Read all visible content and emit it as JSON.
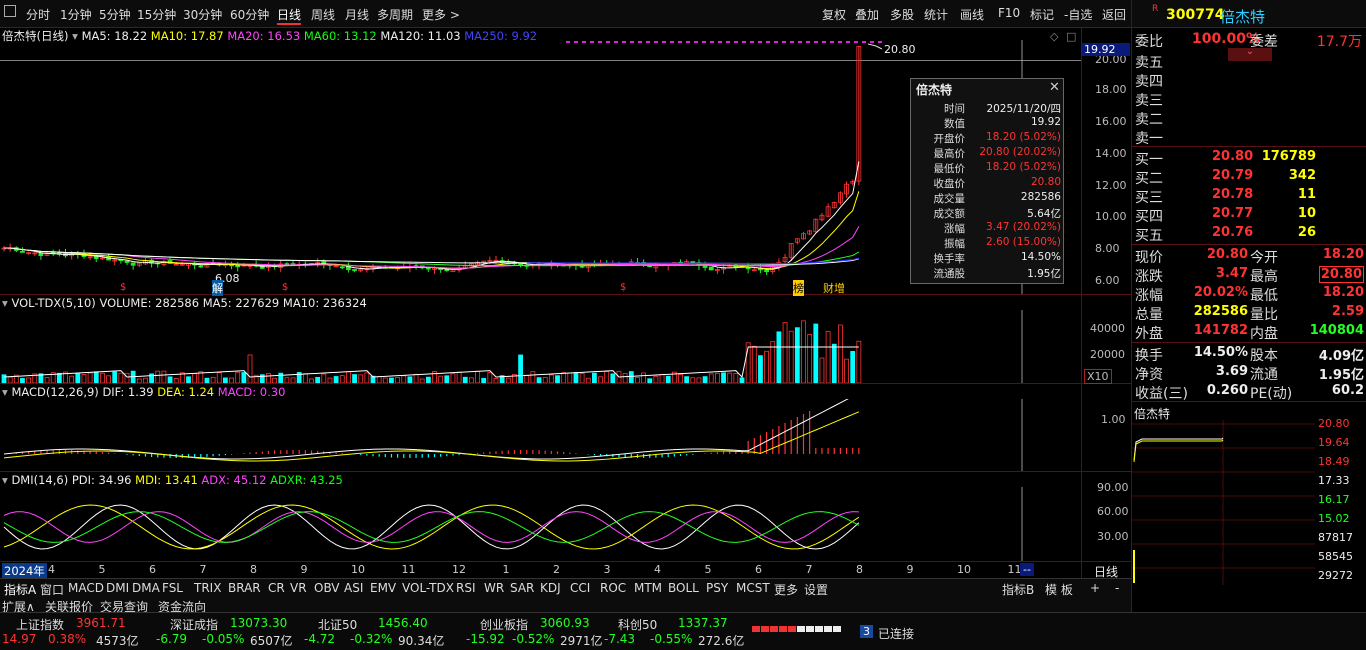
{
  "toolbar": {
    "periods": [
      "分时",
      "1分钟",
      "5分钟",
      "15分钟",
      "30分钟",
      "60分钟",
      "日线",
      "周线",
      "月线",
      "多周期",
      "更多 >"
    ],
    "actions": [
      "复权",
      "叠加",
      "多股",
      "统计",
      "画线",
      "F10",
      "标记",
      "-自选",
      "返回"
    ]
  },
  "stock": {
    "code": "300774",
    "name": "倍杰特",
    "badge": "R"
  },
  "ma_bar": {
    "title": "倍杰特(日线)",
    "ma5": "MA5: 18.22",
    "ma10": "MA10: 17.87",
    "ma20": "MA20: 16.53",
    "ma60": "MA60: 13.12",
    "ma120": "MA120: 11.03",
    "ma250": "MA250: 9.92"
  },
  "price_axis": [
    "20.00",
    "18.00",
    "16.00",
    "14.00",
    "12.00",
    "10.00",
    "8.00",
    "6.00"
  ],
  "chart_labels": {
    "high": "20.80",
    "low": "6.08",
    "cursor": "19.92",
    "marker_jie": "解",
    "marker_bang": "榜",
    "marker_zeng": "财增"
  },
  "vol_bar": {
    "title": "VOL-TDX(5,10)",
    "volume": "VOLUME: 282586",
    "ma5": "MA5: 227629",
    "ma10": "MA10: 236324"
  },
  "vol_axis": [
    "40000",
    "20000",
    "X10"
  ],
  "macd_bar": {
    "title": "MACD(12,26,9)",
    "dif": "DIF: 1.39",
    "dea": "DEA: 1.24",
    "macd": "MACD: 0.30"
  },
  "macd_axis": [
    "1.00"
  ],
  "dmi_bar": {
    "title": "DMI(14,6)",
    "pdi": "PDI: 34.96",
    "mdi": "MDI: 13.41",
    "adx": "ADX: 45.12",
    "adxr": "ADXR: 43.25"
  },
  "dmi_axis": [
    "90.00",
    "60.00",
    "30.00"
  ],
  "date_axis": {
    "year": "2024年",
    "months": [
      "4",
      "5",
      "6",
      "7",
      "8",
      "9",
      "10",
      "11",
      "12",
      "1",
      "2",
      "3",
      "4",
      "5",
      "6",
      "7",
      "8",
      "9",
      "10",
      "11"
    ],
    "cursor": "--",
    "right": "日线"
  },
  "tooltip": {
    "title": "倍杰特",
    "rows": [
      [
        "时间",
        "2025/11/20/四"
      ],
      [
        "数值",
        "19.92"
      ],
      [
        "开盘价",
        "18.20 (5.02%)"
      ],
      [
        "最高价",
        "20.80 (20.02%)"
      ],
      [
        "最低价",
        "18.20 (5.02%)"
      ],
      [
        "收盘价",
        "20.80"
      ],
      [
        "成交量",
        "282586"
      ],
      [
        "成交额",
        "5.64亿"
      ],
      [
        "涨幅",
        "3.47 (20.02%)"
      ],
      [
        "振幅",
        "2.60 (15.00%)"
      ],
      [
        "换手率",
        "14.50%"
      ],
      [
        "流通股",
        "1.95亿"
      ]
    ]
  },
  "quote": {
    "weibi": "委比",
    "weibi_v": "100.00%",
    "weicha": "委差",
    "weicha_v": "17.7万",
    "sells": [
      [
        "卖五",
        ""
      ],
      [
        "卖四",
        ""
      ],
      [
        "卖三",
        ""
      ],
      [
        "卖二",
        ""
      ],
      [
        "卖一",
        ""
      ]
    ],
    "buys": [
      [
        "买一",
        "20.80",
        "176789"
      ],
      [
        "买二",
        "20.79",
        "342"
      ],
      [
        "买三",
        "20.78",
        "11"
      ],
      [
        "买四",
        "20.77",
        "10"
      ],
      [
        "买五",
        "20.76",
        "26"
      ]
    ],
    "stats": [
      [
        "现价",
        "20.80",
        "今开",
        "18.20"
      ],
      [
        "涨跌",
        "3.47",
        "最高",
        "20.80"
      ],
      [
        "涨幅",
        "20.02%",
        "最低",
        "18.20"
      ],
      [
        "总量",
        "282586",
        "量比",
        "2.59"
      ],
      [
        "外盘",
        "141782",
        "内盘",
        "140804"
      ],
      [
        "换手",
        "14.50%",
        "股本",
        "4.09亿"
      ],
      [
        "净资",
        "3.69",
        "流通",
        "1.95亿"
      ],
      [
        "收益(三)",
        "0.260",
        "PE(动)",
        "60.2"
      ]
    ]
  },
  "mini": {
    "title": "倍杰特",
    "axis": [
      "20.80",
      "19.64",
      "18.49",
      "17.33",
      "16.17",
      "15.02",
      "87817",
      "58545",
      "29272"
    ]
  },
  "bottom_tabs": [
    "指标A",
    "窗口",
    "MACD",
    "DMI",
    "DMA",
    "FSL",
    "TRIX",
    "BRAR",
    "CR",
    "VR",
    "OBV",
    "ASI",
    "EMV",
    "VOL-TDX",
    "RSI",
    "WR",
    "SAR",
    "KDJ",
    "CCI",
    "ROC",
    "MTM",
    "BOLL",
    "PSY",
    "MCST",
    "更多",
    "设置"
  ],
  "bottom_tabs_right": [
    "指标B",
    "模 板",
    "+",
    "-"
  ],
  "ext_tabs": [
    "扩展∧",
    "关联报价",
    "交易查询",
    "资金流向"
  ],
  "status": {
    "sh": [
      "上证指数",
      "3961.71",
      "14.97",
      "0.38%",
      "4573亿"
    ],
    "sz": [
      "深证成指",
      "13073.30",
      "-6.79",
      "-0.05%",
      "6507亿"
    ],
    "bz": [
      "北证50",
      "1456.40",
      "-4.72",
      "-0.32%",
      "90.34亿"
    ],
    "cy": [
      "创业板指",
      "3060.93",
      "-15.92",
      "-0.52%",
      "2971亿"
    ],
    "kc": [
      "科创50",
      "1337.37",
      "-7.43",
      "-0.55%",
      "272.6亿"
    ],
    "conn": "已连接",
    "conn_n": "3"
  },
  "colors": {
    "up": "#ff3333",
    "down": "#22ee22",
    "ma5": "#ffffff",
    "ma10": "#ffff00",
    "ma20": "#ff44ff",
    "ma60": "#22ff22",
    "ma250": "#3333ff"
  }
}
